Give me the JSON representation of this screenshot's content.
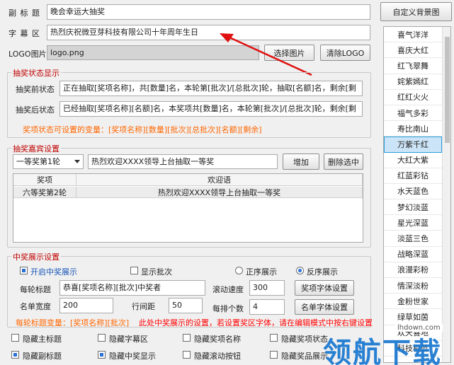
{
  "top": {
    "subtitle_label": "副 标 题",
    "subtitle_value": "晚会幸运大抽奖",
    "caption_label": "字 幕 区",
    "caption_value": "热烈庆祝微豆芽科技有限公司十年周年生日",
    "logo_label": "LOGO图片",
    "logo_value": "logo.png",
    "select_image": "选择图片",
    "clear_logo": "清除LOGO",
    "custom_bg": "自定义背景图"
  },
  "status": {
    "title": "抽奖状态显示",
    "before_label": "抽奖前状态",
    "before_value": "正在抽取[奖项名称]，共[数量]名，本轮第[批次]/[总批次]轮，抽取[名额]名，剩余[剩",
    "after_label": "抽奖后状态",
    "after_value": "已经抽取[奖项名称][名额]名，本奖项共[数量]名，本轮第[批次]/[总批次]轮，剩余[剩",
    "hint": "奖项状态可设置的变量：[奖项名称][数量][批次][总批次][名额][剩余]"
  },
  "guest": {
    "title": "抽奖嘉宾设置",
    "dropdown_value": "一等奖第1轮",
    "welcome_value": "热烈欢迎XXXX领导上台抽取一等奖",
    "add": "增加",
    "delete": "删除选中",
    "col_prize": "奖项",
    "col_welcome": "欢迎语",
    "rows": [
      {
        "prize": "六等奖第2轮",
        "welcome": "热烈欢迎XXXX领导上台抽取一等奖"
      }
    ]
  },
  "display": {
    "title": "中奖展示设置",
    "enable_label": "开启中奖展示",
    "show_batch": "显示批次",
    "forward": "正序展示",
    "reverse": "反序展示",
    "round_title_label": "每轮标题",
    "round_title_value": "恭喜[奖项名称][批次]中奖者",
    "scroll_speed_label": "滚动速度",
    "scroll_speed_value": "300",
    "prize_font": "奖项字体设置",
    "list_width_label": "名单宽度",
    "list_width_value": "200",
    "row_spacing_label": "行间距",
    "row_spacing_value": "50",
    "per_row_label": "每排个数",
    "per_row_value": "4",
    "name_font": "名单字体设置",
    "var_hint": "每轮标题变量：[奖项名称][批次]",
    "red_hint": "此处中奖展示的设置，若设置奖区字体，请在编辑模式中按右键设置"
  },
  "hide": {
    "main_title": "隐藏主标题",
    "caption": "隐藏字幕区",
    "prize_name": "隐藏奖项名称",
    "prize_status": "隐藏奖项状态",
    "subtitle": "隐藏副标题",
    "winner_display": "隐藏中奖显示",
    "scroll_button": "隐藏滚动按钮",
    "prize_display": "隐藏奖品展示"
  },
  "themes": [
    "喜气洋洋",
    "喜庆大红",
    "红飞翠舞",
    "姹紫嫣红",
    "红红火火",
    "福气多彩",
    "寿比南山",
    "万紫千红",
    "大红大紫",
    "红蓝彩钻",
    "水天蓝色",
    "梦幻淡蓝",
    "星光深蓝",
    "淡蓝三色",
    "战略深蓝",
    "浪漫彩粉",
    "情深淡粉",
    "金粉世家",
    "绿草如茵",
    "欢天喜地",
    "科技机蓝"
  ],
  "selected_theme": "万紫千红",
  "watermark": {
    "site": "lhdown.com",
    "text": "领航下载"
  }
}
